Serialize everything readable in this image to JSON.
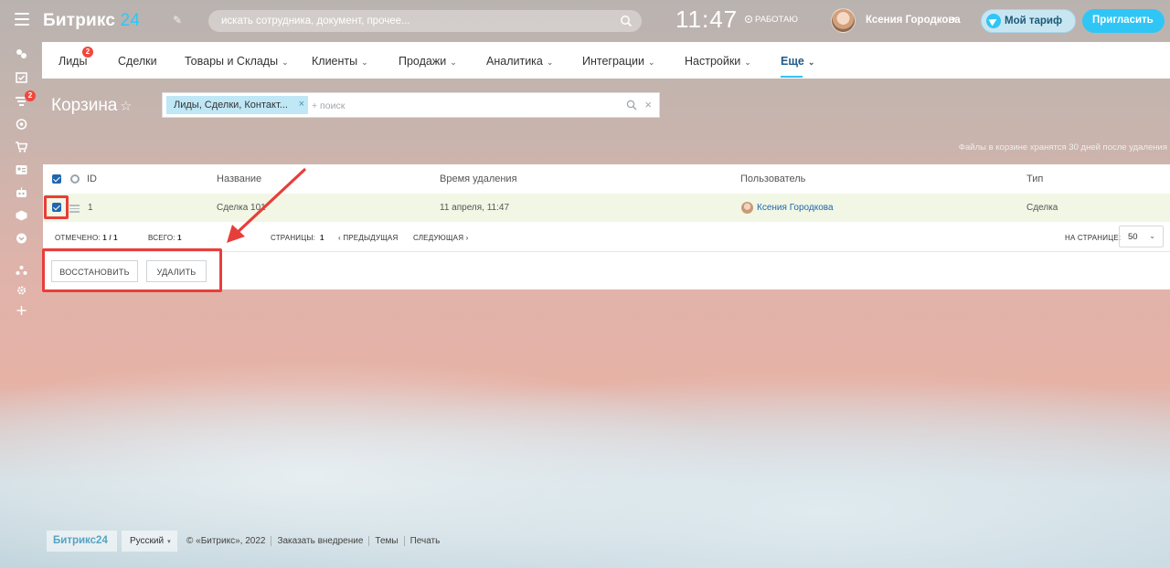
{
  "app": {
    "logo_text": "Битрикс",
    "logo_num": "24",
    "search_placeholder": "искать сотрудника, документ, прочее...",
    "clock": "11:47",
    "work_status": "РАБОТАЮ",
    "user_name": "Ксения Городкова",
    "tariff_label": "Мой тариф",
    "invite_label": "Пригласить",
    "sidebar_badge": "2"
  },
  "nav": {
    "items": [
      {
        "label": "Лиды",
        "badge": "2"
      },
      {
        "label": "Сделки"
      },
      {
        "label": "Товары и Склады"
      },
      {
        "label": "Клиенты"
      },
      {
        "label": "Продажи"
      },
      {
        "label": "Аналитика"
      },
      {
        "label": "Интеграции"
      },
      {
        "label": "Настройки"
      },
      {
        "label": "Еще"
      }
    ]
  },
  "page": {
    "title": "Корзина",
    "filter_chip": "Лиды, Сделки, Контакт...",
    "filter_placeholder": "+ поиск",
    "note": "Файлы в корзине хранятся 30 дней после удаления"
  },
  "grid": {
    "headers": {
      "id": "ID",
      "name": "Название",
      "deleted_at": "Время удаления",
      "user": "Пользователь",
      "type": "Тип"
    },
    "rows": [
      {
        "id": "1",
        "name": "Сделка 101",
        "deleted_at": "11 апреля, 11:47",
        "user": "Ксения Городкова",
        "type": "Сделка",
        "checked": true
      }
    ],
    "footer": {
      "selected_label": "ОТМЕЧЕНО:",
      "selected_value": "1 / 1",
      "total_label": "ВСЕГО:",
      "total_value": "1",
      "pages_label": "СТРАНИЦЫ:",
      "pages_value": "1",
      "prev": "ПРЕДЫДУЩАЯ",
      "next": "СЛЕДУЮЩАЯ",
      "per_page_label": "НА СТРАНИЦЕ:",
      "per_page_value": "50"
    },
    "buttons": {
      "restore": "ВОССТАНОВИТЬ",
      "delete": "УДАЛИТЬ"
    }
  },
  "footer": {
    "logo": "Битрикс24",
    "language": "Русский",
    "links": [
      "© «Битрикс», 2022",
      "Заказать внедрение",
      "Темы",
      "Печать"
    ]
  },
  "colors": {
    "accent": "#2fc6f6",
    "link": "#2067b0",
    "annotation": "#e83e3a",
    "row_selected": "#f1f7e4"
  }
}
